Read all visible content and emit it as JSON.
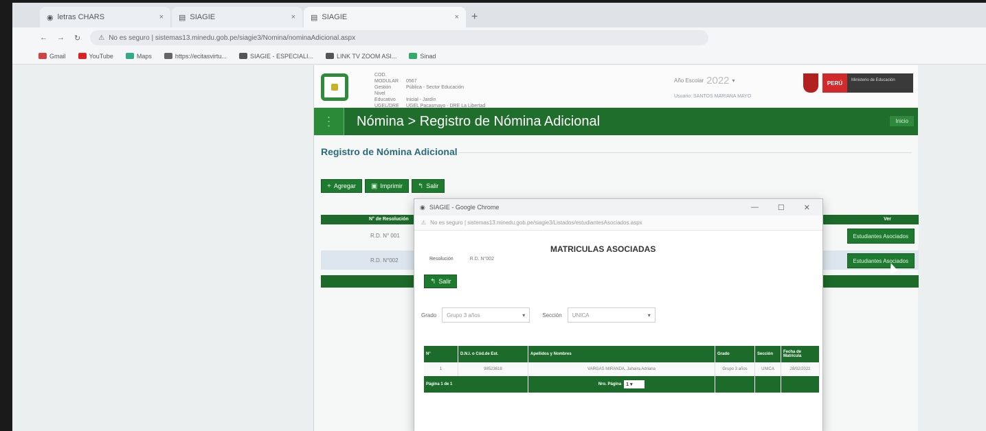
{
  "browser": {
    "tabs": [
      {
        "title": "letras CHARS"
      },
      {
        "title": "SIAGIE"
      },
      {
        "title": "SIAGIE"
      }
    ],
    "tab_close": "×",
    "new_tab": "+",
    "address": "No es seguro | sistemas13.minedu.gob.pe/siagie3/Nomina/nominaAdicional.aspx",
    "bookmarks": [
      {
        "label": "Gmail",
        "color": "#c44"
      },
      {
        "label": "YouTube",
        "color": "#d22"
      },
      {
        "label": "Maps",
        "color": "#3a8"
      },
      {
        "label": "https://ecitasvirtu...",
        "color": "#666"
      },
      {
        "label": "SIAGIE - ESPECIALI...",
        "color": "#555"
      },
      {
        "label": "LINK TV ZOOM ASI...",
        "color": "#555"
      },
      {
        "label": "Sinad",
        "color": "#3a6"
      }
    ]
  },
  "header": {
    "info": [
      {
        "label": "COD. MODULAR",
        "value": "0567"
      },
      {
        "label": "Gestión",
        "value": "Pública - Sector Educación"
      },
      {
        "label": "Nivel Educativo",
        "value": "Inicial - Jardín"
      },
      {
        "label": "UGEL/DRE",
        "value": "UGEL Pacasmayo - DRE La Libertad"
      }
    ],
    "year_label": "Año Escolar",
    "year_value": "2022",
    "user": "Usuario: SANTOS MARIANA MAYO",
    "peru_label": "PERÚ",
    "ministry_label": "Ministerio de Educación"
  },
  "nav": {
    "title": "Nómina > Registro de Nómina Adicional",
    "home": "Inicio"
  },
  "section_title": "Registro de Nómina Adicional",
  "toolbar": {
    "add": "Agregar",
    "print": "Imprimir",
    "exit": "Salir"
  },
  "table": {
    "col_resolution": "N° de Resolución",
    "col_ver": "Ver",
    "rows": [
      {
        "resolution": "R.D. N° 001",
        "action": "Estudiantes Asociados"
      },
      {
        "resolution": "R.D. N°002",
        "action": "Estudiantes Asociados"
      }
    ]
  },
  "popup": {
    "window_title": "SIAGIE - Google Chrome",
    "url": "No es seguro | sistemas13.minedu.gob.pe/siagie3/Listados/estudiantesAsociados.aspx",
    "heading": "MATRICULAS ASOCIADAS",
    "resolution_label": "Resolución",
    "resolution_value": "R.D. N°002",
    "exit": "Salir",
    "grade_label": "Grado",
    "grade_value": "Grupo 3 años",
    "section_label": "Sección",
    "section_value": "UNICA",
    "table": {
      "headers": [
        "N°",
        "D.N.I. o Cód.de Est.",
        "Apellidos y Nombres",
        "Grado",
        "Sección",
        "Fecha de Matrícula"
      ],
      "rows": [
        [
          "1",
          "98523618",
          "VARGAS MIRANDA, Jahaira Adriana",
          "Grupo 3 años",
          "UNICA",
          "28/02/2022"
        ]
      ],
      "footer_pages": "Página 1 de 1",
      "footer_nro_pagina": "Nro. Página",
      "footer_page_value": "1"
    }
  },
  "colors": {
    "brand_green": "#1f6e2b",
    "button_green": "#1e7a2e",
    "title_teal": "#2a6b7a"
  }
}
